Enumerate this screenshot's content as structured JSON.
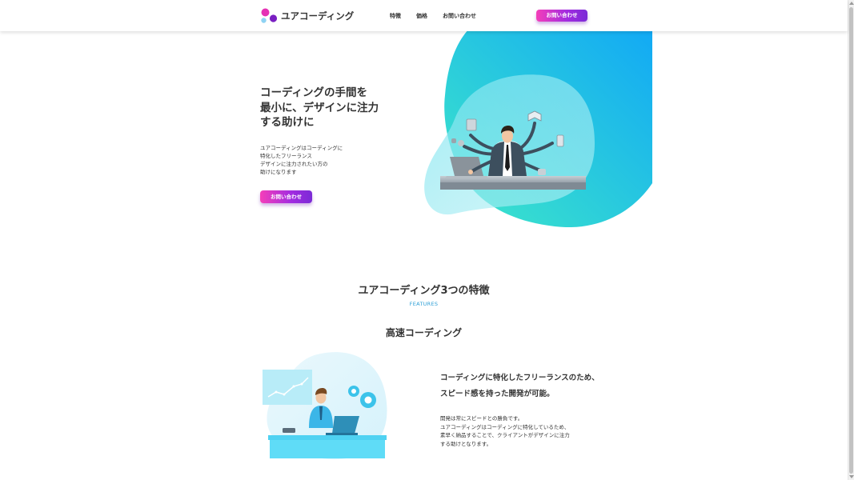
{
  "header": {
    "brand": "ユアコーディング",
    "nav": [
      "特徴",
      "価格",
      "お問い合わせ"
    ],
    "cta_label": "お問い合わせ",
    "logo_colors": [
      "#e531b4",
      "#7a1fc2",
      "#8fd3f3"
    ]
  },
  "hero": {
    "title_lines": [
      "コーディングの手間を",
      "最小に、デザインに注力",
      "する助けに"
    ],
    "desc_lines": [
      "ユアコーディングはコーディングに",
      "特化したフリーランス",
      "デザインに注力されたい方の",
      "助けになります"
    ],
    "cta_label": "お問い合わせ"
  },
  "features": {
    "title": "ユアコーディング3つの特徴",
    "subtitle": "FEATURES",
    "item": {
      "title": "高速コーディング",
      "head_lines": [
        "コーディングに特化したフリーランスのため、",
        "スピード感を持った開発が可能。"
      ],
      "body_lines": [
        "開発は常にスピードとの勝負です。",
        "ユアコーディングはコーディングに特化しているため、",
        "素早く納品することで、クライアントがデザインに注力",
        "する助けとなります。"
      ]
    }
  },
  "colors": {
    "accent_gradient_start": "#f43fb9",
    "accent_gradient_end": "#7b2bd6",
    "hero_blob_start": "#3ee8c8",
    "hero_blob_end": "#12a9f5",
    "feature_subtitle": "#2d9fd6"
  }
}
